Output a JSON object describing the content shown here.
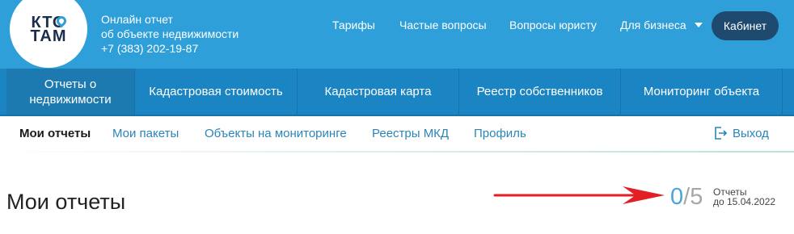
{
  "header": {
    "logo_line1": "КТО",
    "logo_line2": "ТАМ",
    "tagline_line1": "Онлайн отчет",
    "tagline_line2": "об объекте недвижимости",
    "phone": "+7 (383) 202-19-87",
    "links": [
      "Тарифы",
      "Частые вопросы",
      "Вопросы юристу",
      "Для бизнеса"
    ],
    "cabinet_label": "Кабинет",
    "colors": {
      "header_bg": "#2e9fd8",
      "cabinet_bg": "#1d4a6e"
    }
  },
  "main_nav": {
    "items": [
      {
        "label_line1": "Отчеты о",
        "label_line2": "недвижимости"
      },
      {
        "label_line1": "Кадастровая стоимость",
        "label_line2": ""
      },
      {
        "label_line1": "Кадастровая карта",
        "label_line2": ""
      },
      {
        "label_line1": "Реестр собственников",
        "label_line2": ""
      },
      {
        "label_line1": "Мониторинг объекта",
        "label_line2": ""
      }
    ],
    "colors": {
      "bg": "#1b85c3"
    }
  },
  "sub_nav": {
    "items": [
      "Мои отчеты",
      "Мои пакеты",
      "Объекты на мониторинге",
      "Реестры МКД",
      "Профиль"
    ],
    "active_index": 0,
    "logout_label": "Выход"
  },
  "content": {
    "title": "Мои отчеты",
    "counter_used": "0",
    "counter_sep": "/",
    "counter_total": "5",
    "report_label_line1": "Отчеты",
    "report_label_line2": "до 15.04.2022",
    "arrow_color": "#e31e24"
  }
}
